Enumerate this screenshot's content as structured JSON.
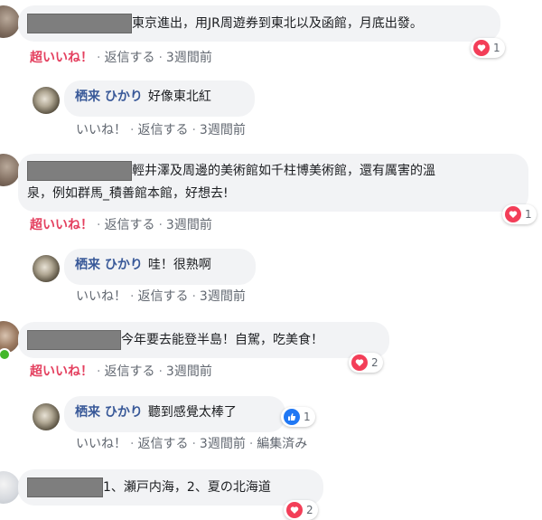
{
  "comments": [
    {
      "text": "東京進出，用JR周遊券到東北以及函館，月底出發。",
      "actions": {
        "reaction": "超いいね！",
        "reply": "返信する",
        "time": "3週間前"
      },
      "reaction_count": "1",
      "reply": {
        "name": "栖来 ひかり",
        "text": "好像東北紅",
        "actions": {
          "like": "いいね！",
          "reply": "返信する",
          "time": "3週間前"
        }
      }
    },
    {
      "text_line1": "輕井澤及周邊的美術館如千柱博美術館，還有厲害的溫",
      "text_line2": "泉，例如群馬_積善館本館，好想去!",
      "actions": {
        "reaction": "超いいね！",
        "reply": "返信する",
        "time": "3週間前"
      },
      "reaction_count": "1",
      "reply": {
        "name": "栖来 ひかり",
        "text": "哇！很熟啊",
        "actions": {
          "like": "いいね！",
          "reply": "返信する",
          "time": "3週間前"
        }
      }
    },
    {
      "text": "今年要去能登半島！自駕，吃美食！",
      "actions": {
        "reaction": "超いいね！",
        "reply": "返信する",
        "time": "3週間前"
      },
      "reaction_count": "2",
      "reply": {
        "name": "栖来 ひかり",
        "text": "聽到感覺太棒了",
        "reaction_count": "1",
        "actions": {
          "like": "いいね！",
          "reply": "返信する",
          "time": "3週間前",
          "edited": "編集済み"
        }
      }
    },
    {
      "text": "1、瀬戸内海，2、夏の北海道",
      "reaction_count": "2"
    }
  ],
  "colors": {
    "accent": "#385898",
    "super_like": "#e4405f",
    "heart": "#f33e58",
    "like": "#2078f4",
    "bubble": "#f2f3f5"
  }
}
